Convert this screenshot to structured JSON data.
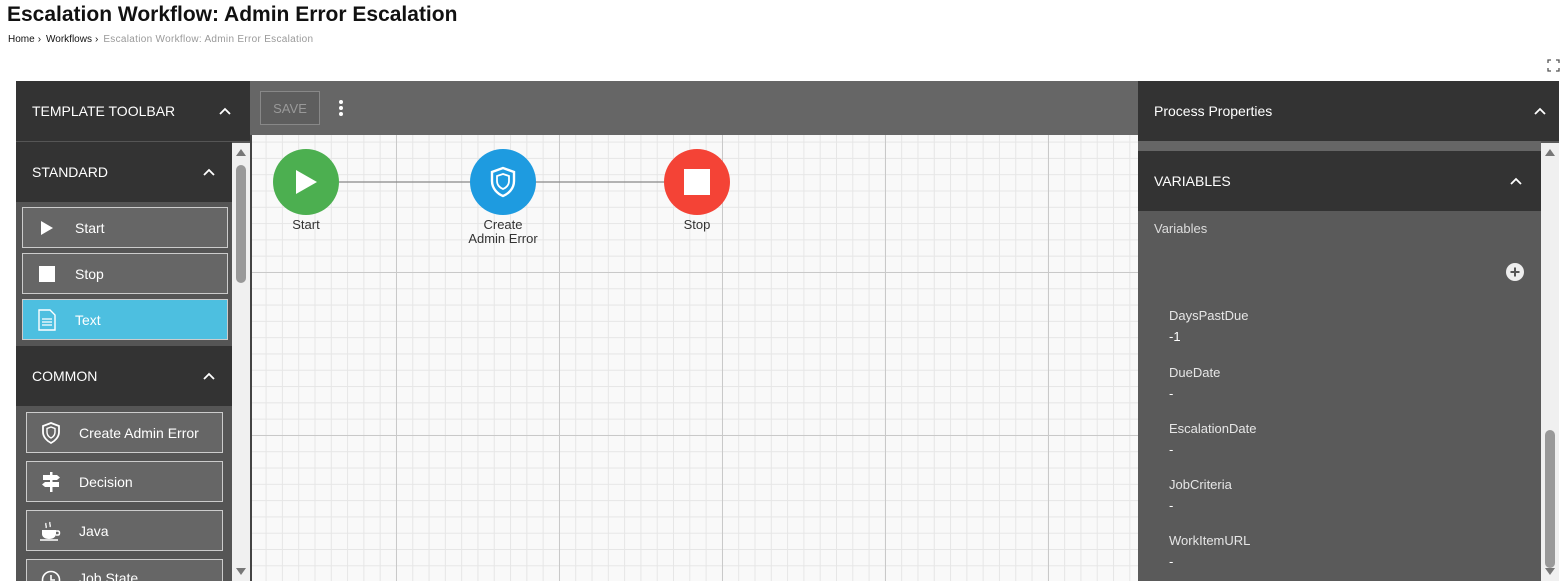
{
  "page": {
    "title": "Escalation Workflow: Admin Error Escalation",
    "breadcrumb": [
      {
        "label": "Home"
      },
      {
        "label": "Workflows"
      },
      {
        "label": "Escalation Workflow: Admin Error Escalation"
      }
    ]
  },
  "toolbar": {
    "header": "TEMPLATE TOOLBAR",
    "standard": {
      "header": "STANDARD",
      "items": [
        {
          "label": "Start",
          "icon": "play-icon"
        },
        {
          "label": "Stop",
          "icon": "stop-icon"
        },
        {
          "label": "Text",
          "icon": "document-icon",
          "active": true
        }
      ]
    },
    "common": {
      "header": "COMMON",
      "items": [
        {
          "label": "Create Admin Error",
          "icon": "shield-icon"
        },
        {
          "label": "Decision",
          "icon": "signpost-icon"
        },
        {
          "label": "Java",
          "icon": "coffee-icon"
        },
        {
          "label": "Job State",
          "icon": "clock-icon"
        }
      ]
    }
  },
  "canvas": {
    "save_label": "SAVE",
    "nodes": [
      {
        "label": "Start",
        "color": "#4caf50",
        "icon": "play-icon"
      },
      {
        "label": "Create\nAdmin Error",
        "color": "#1e9be0",
        "icon": "shield-icon"
      },
      {
        "label": "Stop",
        "color": "#f44336",
        "icon": "stop-icon"
      }
    ]
  },
  "properties": {
    "header": "Process Properties",
    "variables_header": "VARIABLES",
    "variables_label": "Variables",
    "variables": [
      {
        "name": "DaysPastDue",
        "value": "-1"
      },
      {
        "name": "DueDate",
        "value": "-"
      },
      {
        "name": "EscalationDate",
        "value": "-"
      },
      {
        "name": "JobCriteria",
        "value": "-"
      },
      {
        "name": "WorkItemURL",
        "value": "-"
      }
    ]
  }
}
